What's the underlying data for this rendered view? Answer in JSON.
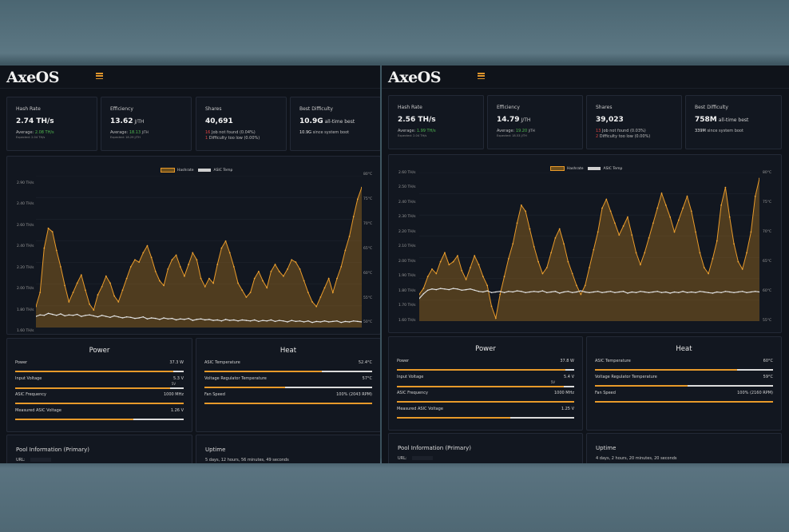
{
  "colors": {
    "accent": "#e89a2a",
    "positive": "#4fb84f",
    "negative": "#e04343",
    "temp_line": "#d9d9d9",
    "background": "#0f131a"
  },
  "dashboards": [
    {
      "logo": "AxeOS",
      "stats": {
        "hashrate": {
          "label": "Hash Rate",
          "value": "2.74 TH/s",
          "avg_prefix": "Average:",
          "avg": "2.08 TH/s",
          "expected": "Expected: 2.04 TH/s"
        },
        "efficiency": {
          "label": "Efficiency",
          "value": "13.62",
          "unit": "J/TH",
          "avg_prefix": "Average:",
          "avg": "18.13",
          "avg_unit": "J/TH",
          "expected": "Expected: 18.29 J/TH"
        },
        "shares": {
          "label": "Shares",
          "value": "40,691",
          "rej1_count": "16",
          "rej1_text": "Job not found (0.04%)",
          "rej2_count": "1",
          "rej2_text": "Difficulty too low (0.00%)"
        },
        "best": {
          "label": "Best Difficulty",
          "value": "10.9G",
          "value_suffix": "all-time best",
          "since_value": "10.9G",
          "since_text": "since system boot"
        }
      },
      "chart_legend": {
        "hashrate": "Hashrate",
        "temp": "ASIC Temp"
      },
      "y_left": [
        "2.90 TH/s",
        "2.40 TH/s",
        "2.60 TH/s",
        "2.40 TH/s",
        "2.20 TH/s",
        "2.00 TH/s",
        "1.80 TH/s",
        "1.60 TH/s"
      ],
      "y_right": [
        "80°C",
        "75°C",
        "70°C",
        "65°C",
        "60°C",
        "55°C",
        "50°C"
      ],
      "power": {
        "title": "Power",
        "rows": [
          {
            "label": "Power",
            "value": "37.3 W"
          },
          {
            "label": "Input Voltage",
            "value": "5.3 V",
            "sub": "5V"
          },
          {
            "label": "ASIC Frequency",
            "value": "1000 MHz"
          },
          {
            "label": "Measured ASIC Voltage",
            "value": "1.26 V"
          }
        ]
      },
      "heat": {
        "title": "Heat",
        "rows": [
          {
            "label": "ASIC Temperature",
            "value": "52.4°C"
          },
          {
            "label": "Voltage Regulator Temperature",
            "value": "57°C"
          },
          {
            "label": "Fan Speed",
            "value": "100% (2043 RPM)"
          }
        ]
      },
      "pool": {
        "title": "Pool Information (Primary)",
        "url_label": "URL:"
      },
      "uptime": {
        "title": "Uptime",
        "text": "5 days, 12 hours, 56 minutes, 49 seconds"
      }
    },
    {
      "logo": "AxeOS",
      "stats": {
        "hashrate": {
          "label": "Hash Rate",
          "value": "2.56 TH/s",
          "avg_prefix": "Average:",
          "avg": "1.99 TH/s",
          "expected": "Expected: 2.04 TH/s"
        },
        "efficiency": {
          "label": "Efficiency",
          "value": "14.79",
          "unit": "J/TH",
          "avg_prefix": "Average:",
          "avg": "19.20",
          "avg_unit": "J/TH",
          "expected": "Expected: 18.53 J/TH"
        },
        "shares": {
          "label": "Shares",
          "value": "39,023",
          "rej1_count": "13",
          "rej1_text": "Job not found (0.03%)",
          "rej2_count": "2",
          "rej2_text": "Difficulty too low (0.00%)"
        },
        "best": {
          "label": "Best Difficulty",
          "value": "758M",
          "value_suffix": "all-time best",
          "since_value": "339M",
          "since_text": "since system boot"
        }
      },
      "chart_legend": {
        "hashrate": "Hashrate",
        "temp": "ASIC Temp"
      },
      "y_left": [
        "2.60 TH/s",
        "2.50 TH/s",
        "2.40 TH/s",
        "2.30 TH/s",
        "2.20 TH/s",
        "2.10 TH/s",
        "2.00 TH/s",
        "1.90 TH/s",
        "1.80 TH/s",
        "1.70 TH/s",
        "1.60 TH/s"
      ],
      "y_right": [
        "80°C",
        "75°C",
        "70°C",
        "65°C",
        "60°C",
        "55°C"
      ],
      "power": {
        "title": "Power",
        "rows": [
          {
            "label": "Power",
            "value": "37.8 W"
          },
          {
            "label": "Input Voltage",
            "value": "5.4 V",
            "sub": "5V"
          },
          {
            "label": "ASIC Frequency",
            "value": "1000 MHz"
          },
          {
            "label": "Measured ASIC Voltage",
            "value": "1.25 V"
          }
        ]
      },
      "heat": {
        "title": "Heat",
        "rows": [
          {
            "label": "ASIC Temperature",
            "value": "60°C"
          },
          {
            "label": "Voltage Regulator Temperature",
            "value": "59°C"
          },
          {
            "label": "Fan Speed",
            "value": "100% (2160 RPM)"
          }
        ]
      },
      "pool": {
        "title": "Pool Information (Primary)",
        "url_label": "URL:"
      },
      "uptime": {
        "title": "Uptime",
        "text": "4 days, 2 hours, 20 minutes, 20 seconds"
      }
    }
  ],
  "chart_data": [
    {
      "type": "line",
      "title": "",
      "series": [
        {
          "name": "Hashrate",
          "axis": "left",
          "unit": "TH/s",
          "values": [
            1.78,
            1.9,
            2.28,
            2.45,
            2.42,
            2.26,
            2.12,
            1.96,
            1.82,
            1.9,
            1.98,
            2.05,
            1.92,
            1.8,
            1.75,
            1.88,
            1.95,
            2.04,
            1.98,
            1.87,
            1.82,
            1.92,
            2.02,
            2.12,
            2.18,
            2.16,
            2.24,
            2.3,
            2.2,
            2.08,
            2.0,
            1.96,
            2.1,
            2.18,
            2.22,
            2.12,
            2.04,
            2.14,
            2.24,
            2.18,
            2.02,
            1.95,
            2.02,
            1.98,
            2.14,
            2.28,
            2.34,
            2.24,
            2.12,
            1.98,
            1.92,
            1.86,
            1.9,
            2.02,
            2.08,
            2.0,
            1.94,
            2.08,
            2.14,
            2.08,
            2.04,
            2.1,
            2.18,
            2.16,
            2.1,
            2.0,
            1.9,
            1.82,
            1.78,
            1.86,
            1.94,
            2.02,
            1.9,
            2.02,
            2.12,
            2.26,
            2.38,
            2.55,
            2.7,
            2.8
          ]
        },
        {
          "name": "ASIC Temp",
          "axis": "right",
          "unit": "°C",
          "values": [
            52.2,
            52.5,
            52.4,
            52.8,
            52.6,
            52.4,
            52.7,
            52.3,
            52.5,
            52.4,
            52.6,
            52.2,
            52.4,
            52.5,
            52.3,
            52.1,
            52.4,
            52.2,
            52.0,
            52.3,
            52.1,
            51.9,
            52.1,
            52.0,
            51.8,
            51.9,
            52.1,
            51.7,
            51.9,
            51.8,
            51.6,
            51.9,
            51.7,
            51.8,
            51.5,
            51.7,
            51.6,
            51.8,
            51.4,
            51.6,
            51.7,
            51.5,
            51.6,
            51.4,
            51.5,
            51.3,
            51.6,
            51.4,
            51.5,
            51.3,
            51.5,
            51.4,
            51.3,
            51.5,
            51.2,
            51.4,
            51.3,
            51.5,
            51.2,
            51.4,
            51.3,
            51.1,
            51.4,
            51.2,
            51.3,
            51.1,
            51.3,
            51.0,
            51.2,
            51.1,
            51.3,
            51.1,
            51.2,
            51.3,
            51.0,
            51.2,
            51.1,
            51.3,
            51.2,
            51.1
          ]
        }
      ],
      "y_left_range": [
        1.6,
        2.9
      ],
      "y_right_range": [
        50,
        80
      ],
      "legend": "top-center"
    },
    {
      "type": "line",
      "title": "",
      "series": [
        {
          "name": "Hashrate",
          "axis": "left",
          "unit": "TH/s",
          "values": [
            1.78,
            1.82,
            1.9,
            1.95,
            1.92,
            2.0,
            2.06,
            1.98,
            2.0,
            2.04,
            1.94,
            1.88,
            1.96,
            2.04,
            1.98,
            1.9,
            1.84,
            1.7,
            1.62,
            1.78,
            1.9,
            2.02,
            2.12,
            2.26,
            2.38,
            2.34,
            2.22,
            2.1,
            2.0,
            1.92,
            1.96,
            2.06,
            2.16,
            2.22,
            2.12,
            2.0,
            1.92,
            1.84,
            1.78,
            1.84,
            1.96,
            2.08,
            2.2,
            2.36,
            2.42,
            2.34,
            2.26,
            2.18,
            2.24,
            2.3,
            2.18,
            2.06,
            1.98,
            2.06,
            2.16,
            2.26,
            2.36,
            2.46,
            2.38,
            2.3,
            2.2,
            2.28,
            2.36,
            2.44,
            2.34,
            2.2,
            2.06,
            1.96,
            1.92,
            2.02,
            2.14,
            2.38,
            2.5,
            2.3,
            2.12,
            2.0,
            1.95,
            2.06,
            2.2,
            2.44,
            2.56
          ]
        },
        {
          "name": "ASIC Temp",
          "axis": "right",
          "unit": "°C",
          "values": [
            58.8,
            59.6,
            60.2,
            60.4,
            60.3,
            60.5,
            60.4,
            60.3,
            60.5,
            60.4,
            60.2,
            60.3,
            60.4,
            60.2,
            60.0,
            59.9,
            60.1,
            59.8,
            59.9,
            60.0,
            59.8,
            60.0,
            59.9,
            60.1,
            60.0,
            59.8,
            59.9,
            60.0,
            59.9,
            60.1,
            59.8,
            59.9,
            60.0,
            59.7,
            59.9,
            60.0,
            59.8,
            59.9,
            60.1,
            59.9,
            59.8,
            59.9,
            60.0,
            59.8,
            59.9,
            60.0,
            59.8,
            59.9,
            60.0,
            59.7,
            59.9,
            59.8,
            60.0,
            59.9,
            59.8,
            59.9,
            60.0,
            59.8,
            59.9,
            59.7,
            59.9,
            59.8,
            60.0,
            59.8,
            59.9,
            59.8,
            60.0,
            59.9,
            59.8,
            59.7,
            59.9,
            59.8,
            60.0,
            59.9,
            59.8,
            59.9,
            60.0,
            59.8,
            59.9,
            60.0,
            59.9
          ]
        }
      ],
      "y_left_range": [
        1.6,
        2.6
      ],
      "y_right_range": [
        55,
        80
      ],
      "legend": "top-center"
    }
  ],
  "bar_levels": [
    {
      "power": [
        0.94,
        0.92,
        1.0,
        0.7
      ],
      "heat": [
        0.7,
        0.48,
        1.0
      ]
    },
    {
      "power": [
        0.95,
        0.94,
        1.0,
        0.64
      ],
      "heat": [
        0.8,
        0.52,
        1.0
      ]
    }
  ]
}
